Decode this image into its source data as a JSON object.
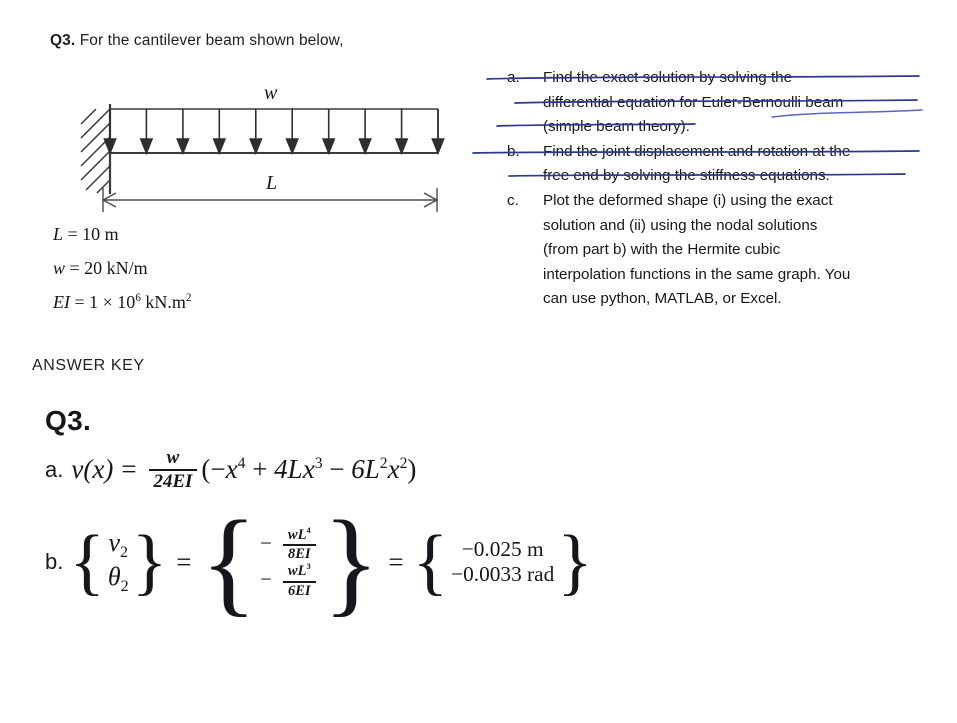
{
  "document": {
    "question_header": {
      "number": "Q3.",
      "text": "For the cantilever beam shown below,"
    },
    "figure": {
      "load_label": "w",
      "span_label": "L",
      "arrow_count": 10,
      "support": "fixed-support-hatched"
    },
    "parameters": [
      {
        "symbol": "L",
        "relation": "=",
        "value": "10",
        "unit": "m"
      },
      {
        "symbol": "w",
        "relation": "=",
        "value": "20",
        "unit": "kN/m"
      },
      {
        "symbol": "EI",
        "relation": "=",
        "value": "1 × 10",
        "exponent": "6",
        "unit": "kN.m",
        "unit_exponent": "2"
      }
    ],
    "parts": [
      {
        "marker": "a.",
        "text": "Find the exact solution by solving the differential equation for Euler-Bernoulli beam (simple beam theory).",
        "lines": [
          "Find   the   exact   solution   by   solving   the",
          "differential equation for Euler-Bernoulli beam",
          "(simple beam theory)."
        ],
        "struck_through": true,
        "annotation": "navy-strikethrough"
      },
      {
        "marker": "b.",
        "text": "Find the joint displacement and rotation at the free end by solving the stiffness equations.",
        "lines": [
          "Find the joint displacement and rotation at the",
          "free end by solving the stiffness equations."
        ],
        "struck_through": true,
        "annotation": "navy-strikethrough"
      },
      {
        "marker": "c.",
        "text": "Plot the deformed shape (i) using the exact solution and (ii) using the nodal solutions (from part b) with the Hermite cubic interpolation functions in the same graph. You can use python, MATLAB, or Excel.",
        "lines": [
          "Plot   the   deformed   shape   (i)   using   the   exact",
          "solution   and   (ii)   using   the   nodal   solutions",
          "(from   part   b)   with   the   Hermite   cubic",
          "interpolation functions in the same graph. You",
          "can use python, MATLAB, or Excel."
        ],
        "struck_through": false,
        "annotation": "blue-hand-drawn-circle"
      }
    ],
    "answer_key_label": "ANSWER KEY",
    "answer": {
      "heading": "Q3.",
      "part_a": {
        "tag": "a.",
        "lhs": "v(x)",
        "equals": "=",
        "fraction_numerator": "w",
        "fraction_denominator": "24EI",
        "expression": "(−x⁴ + 4Lx³ − 6L²x²)",
        "terms": {
          "open_paren": "(",
          "t1_sign": "−",
          "t1_base": "x",
          "t1_exp": "4",
          "t2_sign": "+",
          "t2_coef": "4L",
          "t2_base": "x",
          "t2_exp": "3",
          "t3_sign": "−",
          "t3_coef": "6L",
          "t3_coef_exp": "2",
          "t3_base": "x",
          "t3_exp": "2",
          "close_paren": ")"
        }
      },
      "part_b": {
        "tag": "b.",
        "vector_symbols": [
          {
            "symbol": "v",
            "sub": "2"
          },
          {
            "symbol": "θ",
            "sub": "2"
          }
        ],
        "equals_1": "=",
        "symbolic": [
          {
            "sign": "−",
            "num": "wL",
            "num_exp": "4",
            "den": "8EI"
          },
          {
            "sign": "−",
            "num": "wL",
            "num_exp": "3",
            "den": "6EI"
          }
        ],
        "equals_2": "=",
        "numeric": [
          "−0.025 m",
          "−0.0033 rad"
        ]
      }
    },
    "colors": {
      "text": "#17181c",
      "annotation_navy": "#2b3a8f",
      "annotation_blue": "#5b63c4",
      "diagram_line": "#3a3a3a",
      "background": "#ffffff"
    }
  }
}
